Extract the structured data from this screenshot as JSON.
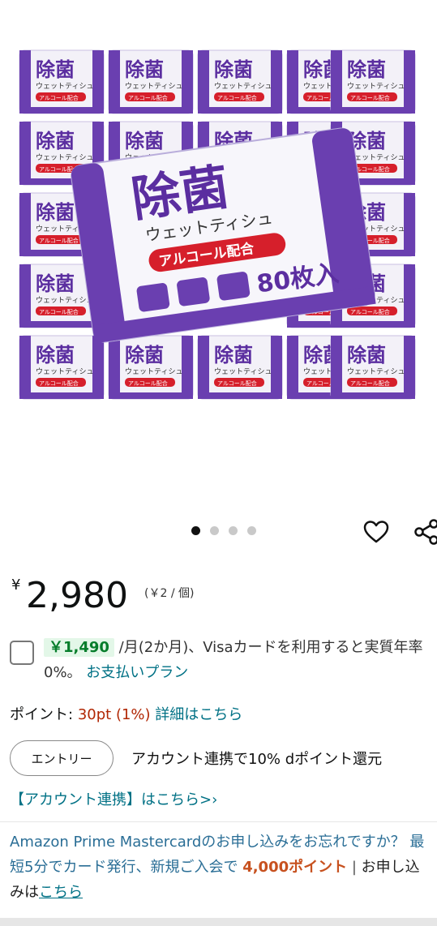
{
  "product": {
    "pack_title": "除菌",
    "pack_subtitle": "ウェットティシュ",
    "pack_tag": "アルコール配合",
    "pack_count": "80枚入"
  },
  "carousel": {
    "count": 4,
    "active_index": 0
  },
  "price": {
    "currency": "¥",
    "amount": "2,980",
    "unit": "(￥2 / 個)"
  },
  "installment": {
    "badge": "￥1,490",
    "text": "/月(2か月)、Visaカードを利用すると実質年率0%。",
    "link": "お支払いプラン"
  },
  "points": {
    "label": "ポイント:",
    "value": "30pt",
    "percent": "(1%)",
    "link": "詳細はこちら"
  },
  "entry": {
    "button": "エントリー",
    "text": "アカウント連携で10% dポイント還元"
  },
  "account_link": "【アカウント連携】はこちら>›",
  "promo": {
    "text": "Amazon Prime Mastercardのお申し込みをお忘れですか？ 最短5分でカード発行、新規ご入会で",
    "highlight": "4,000ポイント",
    "separator": "|",
    "apply_text": "お申し込みは",
    "apply_link": "こちら"
  },
  "colors": {
    "accent_purple": "#6a3fb0",
    "link_teal": "#007185",
    "price_red": "#b12704",
    "badge_green": "#067d2b"
  }
}
